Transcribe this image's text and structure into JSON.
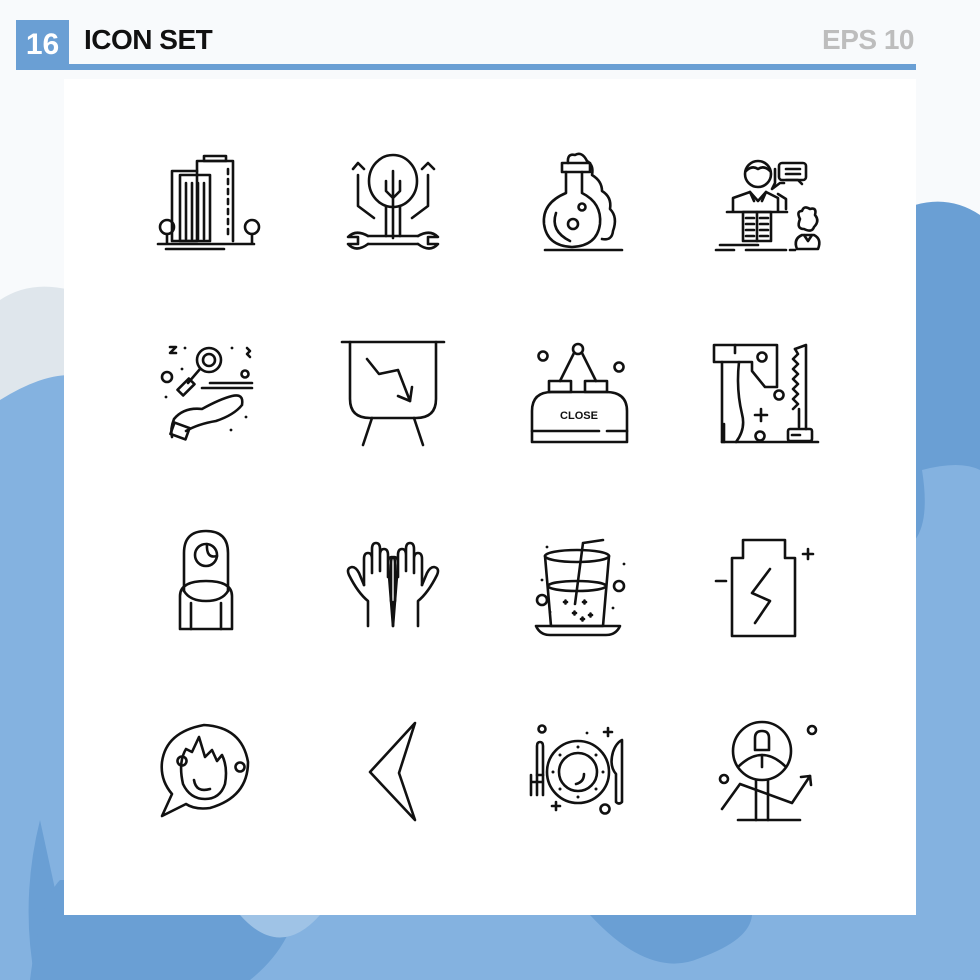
{
  "header": {
    "count": "16",
    "title": "ICON SET",
    "format": "EPS 10"
  },
  "colors": {
    "accent": "#6a9fd4",
    "accent_light": "#84b2e0",
    "background": "#f8fafc",
    "panel": "#ffffff",
    "icon_stroke": "#111111",
    "muted_text": "#bdbdbd"
  },
  "icons": [
    {
      "name": "office-building-icon",
      "label": ""
    },
    {
      "name": "tree-wrench-growth-icon",
      "label": ""
    },
    {
      "name": "chemistry-flask-smoke-icon",
      "label": ""
    },
    {
      "name": "speaker-podium-conversation-icon",
      "label": ""
    },
    {
      "name": "female-symbol-hand-icon",
      "label": ""
    },
    {
      "name": "presentation-board-decline-icon",
      "label": ""
    },
    {
      "name": "close-hanging-sign-icon",
      "label": "CLOSE"
    },
    {
      "name": "axe-saw-tools-icon",
      "label": ""
    },
    {
      "name": "hijab-woman-icon",
      "label": ""
    },
    {
      "name": "raised-hands-icon",
      "label": ""
    },
    {
      "name": "drink-glass-straw-icon",
      "label": ""
    },
    {
      "name": "battery-charging-icon",
      "label": ""
    },
    {
      "name": "fire-chat-bubble-icon",
      "label": ""
    },
    {
      "name": "arrow-left-pointer-icon",
      "label": ""
    },
    {
      "name": "dinner-plate-cutlery-icon",
      "label": ""
    },
    {
      "name": "user-growth-chart-icon",
      "label": ""
    }
  ]
}
